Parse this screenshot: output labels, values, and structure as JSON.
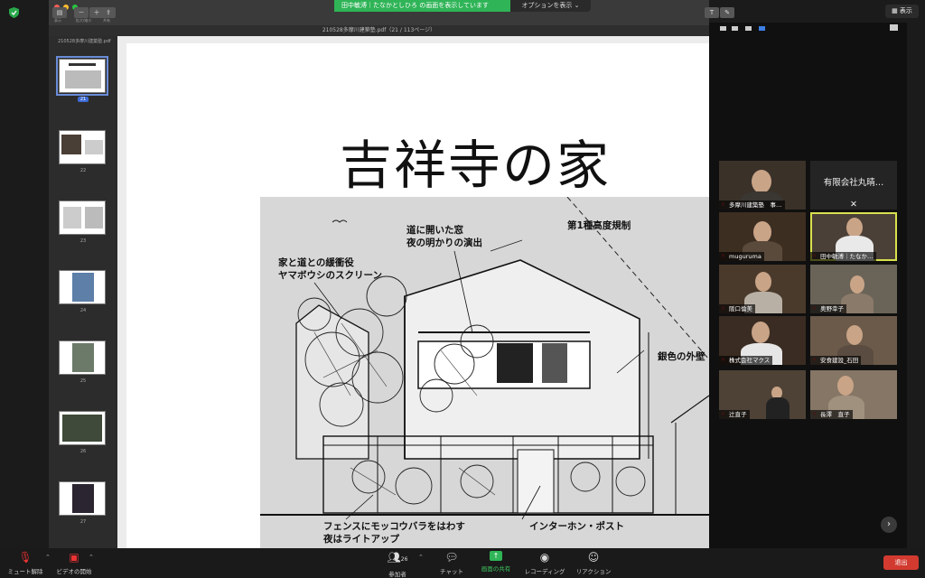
{
  "share_banner": {
    "text": "田中敏溥｜たなかとしひろ の画面を表示しています",
    "options": "オプションを表示"
  },
  "view_button": "表示",
  "preview": {
    "window_title": "210528多摩川建築塾.pdf（21 / 113ページ）",
    "sidebar_file": "210528多摩川建築塾.pdf",
    "toolbar_labels": [
      "表示",
      "拡大/縮小",
      "共有"
    ],
    "thumbnails": [
      {
        "num": "21",
        "selected": true
      },
      {
        "num": "22",
        "selected": false
      },
      {
        "num": "23",
        "selected": false
      },
      {
        "num": "24",
        "selected": false
      },
      {
        "num": "25",
        "selected": false
      },
      {
        "num": "26",
        "selected": false
      },
      {
        "num": "27",
        "selected": false
      }
    ],
    "page": {
      "title": "吉祥寺の家",
      "notes": {
        "n1": [
          "道に開いた窓",
          "夜の明かりの演出"
        ],
        "n2": [
          "第1種高度規制"
        ],
        "n3": [
          "家と道との緩衝役",
          "ヤマボウシのスクリーン"
        ],
        "n4": [
          "銀色の外壁"
        ],
        "n5": [
          "フェンスにモッコウバラをはわす",
          "夜はライトアップ"
        ],
        "n6": [
          "インターホン・ポスト"
        ]
      }
    }
  },
  "participants": [
    {
      "name": "多摩川建築塾　事…",
      "bg": "#3b3530"
    },
    {
      "name": "有限会社丸晴…",
      "bg": "#242424",
      "text_only": true
    },
    {
      "name": "muguruma",
      "bg": "#3d2e22"
    },
    {
      "name": "田中敏溥｜たなか…",
      "bg": "#4a4038",
      "active": true
    },
    {
      "name": "阪口倫美",
      "bg": "#4a3a2c"
    },
    {
      "name": "奥野幸子",
      "bg": "#6a6458"
    },
    {
      "name": "株式会社マクス",
      "bg": "#3a2c22"
    },
    {
      "name": "安食建設_石田",
      "bg": "#6b5a4a"
    },
    {
      "name": "辻直子",
      "bg": "#4e4236"
    },
    {
      "name": "長澤　直子",
      "bg": "#857665"
    }
  ],
  "bottom_bar": {
    "mute": "ミュート解除",
    "video": "ビデオの開始",
    "participants": "参加者",
    "participants_count": "26",
    "chat": "チャット",
    "share": "画面の共有",
    "record": "レコーディング",
    "reaction": "リアクション",
    "end": "退出"
  },
  "colors": {
    "share_green": "#2fb457",
    "end_red": "#d23a30",
    "active_border": "#d8e04d"
  }
}
